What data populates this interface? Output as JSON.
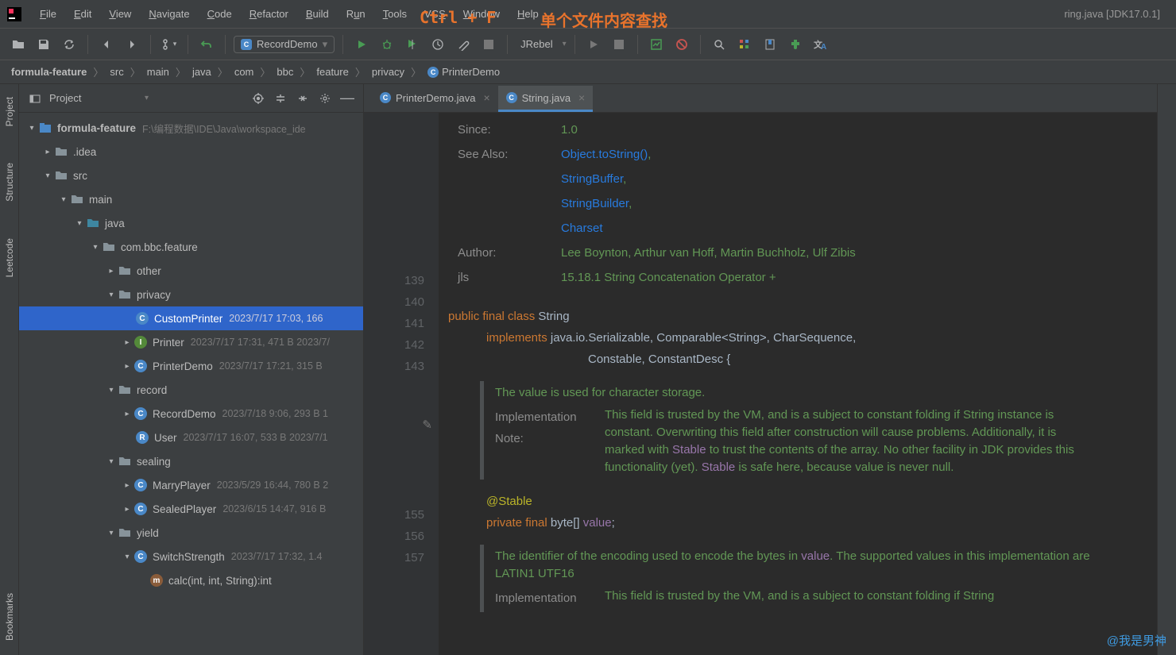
{
  "overlay": {
    "shortcut": "Ctrl + F",
    "desc": "单个文件内容查找"
  },
  "title_suffix": "ring.java [JDK17.0.1]",
  "menu": [
    "File",
    "Edit",
    "View",
    "Navigate",
    "Code",
    "Refactor",
    "Build",
    "Run",
    "Tools",
    "VCS",
    "Window",
    "Help"
  ],
  "run_config": {
    "name": "RecordDemo"
  },
  "jrebel_label": "JRebel",
  "breadcrumbs": [
    "formula-feature",
    "src",
    "main",
    "java",
    "com",
    "bbc",
    "feature",
    "privacy",
    "PrinterDemo"
  ],
  "rail_tabs": [
    "Project",
    "Structure",
    "Leetcode",
    "Bookmarks"
  ],
  "panel": {
    "title": "Project"
  },
  "tree": {
    "root": {
      "name": "formula-feature",
      "path": "F:\\编程数据\\IDE\\Java\\workspace_ide"
    },
    "idea": ".idea",
    "src": "src",
    "main": "main",
    "java": "java",
    "pkg": "com.bbc.feature",
    "other": "other",
    "privacy": "privacy",
    "custom_printer": {
      "name": "CustomPrinter",
      "meta": "2023/7/17 17:03, 166"
    },
    "printer": {
      "name": "Printer",
      "meta": "2023/7/17 17:31, 471 B 2023/7/"
    },
    "printer_demo": {
      "name": "PrinterDemo",
      "meta": "2023/7/17 17:21, 315 B"
    },
    "record": "record",
    "record_demo": {
      "name": "RecordDemo",
      "meta": "2023/7/18 9:06, 293 B 1"
    },
    "user": {
      "name": "User",
      "meta": "2023/7/17 16:07, 533 B 2023/7/1"
    },
    "sealing": "sealing",
    "marry": {
      "name": "MarryPlayer",
      "meta": "2023/5/29 16:44, 780 B 2"
    },
    "sealed": {
      "name": "SealedPlayer",
      "meta": "2023/6/15 14:47, 916 B"
    },
    "yield": "yield",
    "switch_s": {
      "name": "SwitchStrength",
      "meta": "2023/7/17 17:32, 1.4"
    },
    "calc": "calc(int, int, String):int"
  },
  "tabs": [
    {
      "name": "PrinterDemo.java",
      "active": false
    },
    {
      "name": "String.java",
      "active": true
    }
  ],
  "gutter": {
    "lines1": [
      "139",
      "140",
      "141",
      "142",
      "143"
    ],
    "lines2": [
      "155",
      "156",
      "157"
    ]
  },
  "doc": {
    "since_k": "Since:",
    "since_v": "1.0",
    "see_k": "See Also:",
    "see_links": [
      "Object.toString()",
      "StringBuffer",
      "StringBuilder",
      "Charset"
    ],
    "author_k": "Author:",
    "author_v": "Lee Boynton, Arthur van Hoff, Martin Buchholz, Ulf Zibis",
    "jls_k": "jls",
    "jls_v": "15.18.1 String Concatenation Operator +"
  },
  "code": {
    "decl1": "public final class ",
    "decl1_name": "String",
    "impl": "implements ",
    "impl_list": "java.io.Serializable, Comparable<String>, CharSequence,",
    "impl_list2": "Constable, ConstantDesc {",
    "doc1": "The value is used for character storage.",
    "impl_note_label": "Implementation Note:",
    "impl_note_text_a": "This field is trusted by the VM, and is a subject to constant folding if String instance is constant. Overwriting this field after construction will cause problems. Additionally, it is marked with ",
    "stable_ref": "Stable",
    "impl_note_text_b": " to trust the contents of the array. No other facility in JDK provides this functionality (yet). ",
    "impl_note_text_c": " is safe here, because value is never null.",
    "ann": "@Stable",
    "field": "private final byte[] value;",
    "doc2_a": "The identifier of the encoding used to encode the bytes in ",
    "value_ref": "value",
    "doc2_b": ". The supported values in this implementation are LATIN1 UTF16",
    "impl_note2": "This field is trusted by the VM, and is a subject to constant folding if String"
  },
  "watermark": "@我是男神"
}
